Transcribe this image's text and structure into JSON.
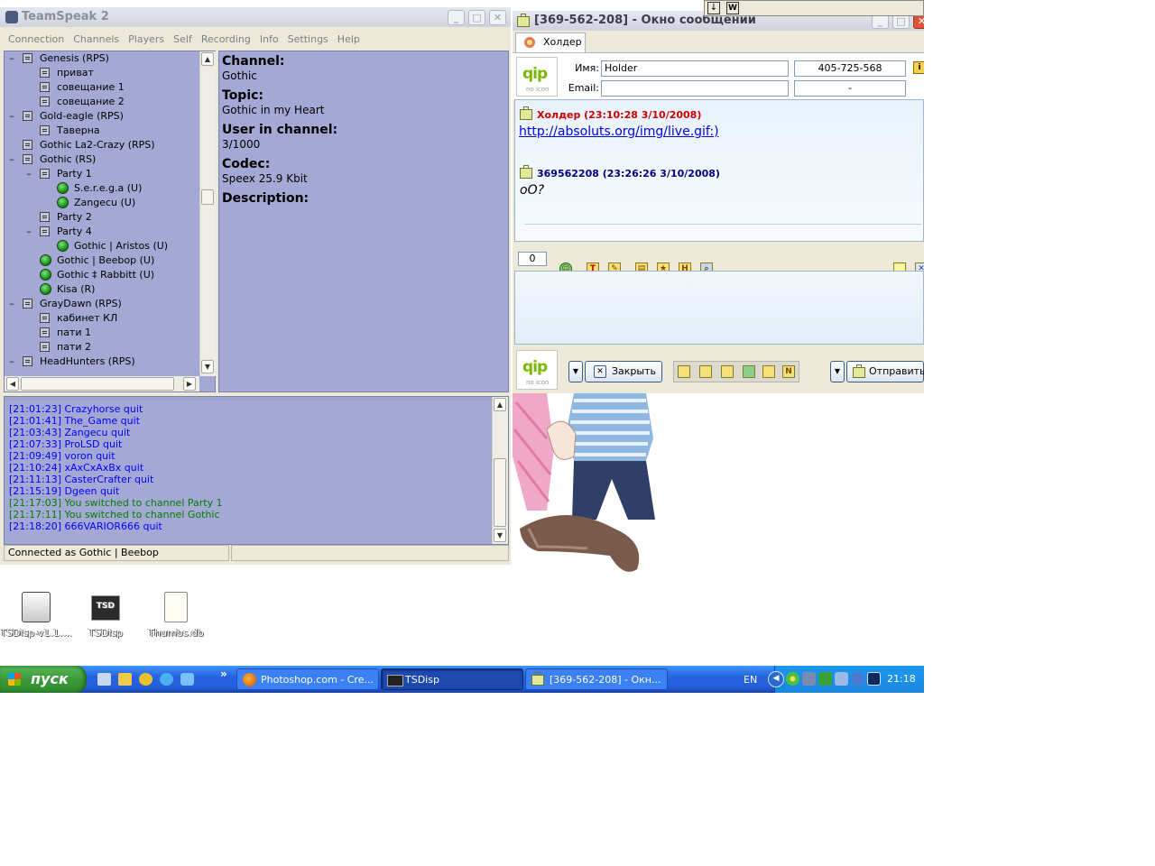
{
  "teamspeak": {
    "title": "TeamSpeak 2",
    "menu": [
      "Connection",
      "Channels",
      "Players",
      "Self",
      "Recording",
      "Info",
      "Settings",
      "Help"
    ],
    "tree": [
      {
        "toggle": "–",
        "label": "Genesis   (RPS)",
        "type": "channel"
      },
      {
        "label": "приват",
        "type": "channel"
      },
      {
        "label": "совещание 1",
        "type": "channel"
      },
      {
        "label": "совещание 2",
        "type": "channel"
      },
      {
        "toggle": "–",
        "label": "Gold-eagle   (RPS)",
        "type": "channel"
      },
      {
        "label": "Таверна",
        "type": "channel"
      },
      {
        "label": "Gothic La2-Crazy   (RPS)",
        "type": "channel"
      },
      {
        "toggle": "–",
        "label": "Gothic   (RS)",
        "type": "channel"
      },
      {
        "toggle": "–",
        "label": "Party 1",
        "type": "channel"
      },
      {
        "label": "S.e.r.e.g.a  (U)",
        "type": "user"
      },
      {
        "label": "Zangecu  (U)",
        "type": "user"
      },
      {
        "label": "Party 2",
        "type": "channel"
      },
      {
        "toggle": "–",
        "label": "Party 4",
        "type": "channel"
      },
      {
        "label": "Gothic | Aristos  (U)",
        "type": "user"
      },
      {
        "label": "Gothic | Beebop  (U)",
        "type": "user"
      },
      {
        "label": "Gothic ‡ Rabbitt  (U)",
        "type": "user"
      },
      {
        "label": "Kisa  (R)",
        "type": "user"
      },
      {
        "toggle": "–",
        "label": "GrayDawn   (RPS)",
        "type": "channel"
      },
      {
        "label": "кабинет КЛ",
        "type": "channel"
      },
      {
        "label": "пати 1",
        "type": "channel"
      },
      {
        "label": "пати 2",
        "type": "channel"
      },
      {
        "toggle": "–",
        "label": "HeadHunters   (RPS)",
        "type": "channel"
      }
    ],
    "info": {
      "channel_label": "Channel:",
      "channel_value": "Gothic",
      "topic_label": "Topic:",
      "topic_value": "Gothic in my Heart",
      "users_label": "User in channel:",
      "users_value": "3/1000",
      "codec_label": "Codec:",
      "codec_value": "Speex 25.9 Kbit",
      "description_label": "Description:"
    },
    "log": [
      {
        "text": "[21:01:23] Crazyhorse quit",
        "color": "#0000ff"
      },
      {
        "text": "[21:01:41] The_Game quit",
        "color": "#0000ff"
      },
      {
        "text": "[21:03:43] Zangecu quit",
        "color": "#0000ff"
      },
      {
        "text": "[21:07:33] ProLSD quit",
        "color": "#0000ff"
      },
      {
        "text": "[21:09:49] voron quit",
        "color": "#0000ff"
      },
      {
        "text": "[21:10:24] xAxCxAxBx quit",
        "color": "#0000ff"
      },
      {
        "text": "[21:11:13] CasterCrafter quit",
        "color": "#0000ff"
      },
      {
        "text": "[21:15:19] Dgeen quit",
        "color": "#0000ff"
      },
      {
        "text": "[21:17:03] You switched to channel Party 1",
        "color": "#008000"
      },
      {
        "text": "[21:17:11] You switched to channel Gothic",
        "color": "#008000"
      },
      {
        "text": "[21:18:20] 666VARIOR666 quit",
        "color": "#0000ff"
      }
    ],
    "status": "Connected as Gothic | Beebop"
  },
  "qip": {
    "title": "[369-562-208] - Окно сообщений",
    "tab_label": "Холдер",
    "name_label": "Имя:",
    "name_value": "Holder",
    "uin_value": "405-725-568",
    "email_label": "Email:",
    "email_value": "",
    "email_extra": "-",
    "logo_text": "qip",
    "logo_sub": "no icon",
    "messages": [
      {
        "header": "Холдер (23:10:28 3/10/2008)",
        "color": "#cc0000",
        "body": "http://absoluts.org/img/live.gif:)",
        "is_link": true
      },
      {
        "header": "369562208 (23:26:26 3/10/2008)",
        "color": "#000080",
        "body": "oO?",
        "is_link": false
      }
    ],
    "char_count": "0",
    "close_label": "Закрыть",
    "send_label": "Отправить"
  },
  "desktop_icons": [
    {
      "label": "TSDisp-v1.1....",
      "icon": "installer-icon"
    },
    {
      "label": "TSDisp",
      "icon": "tsd-shortcut-icon"
    },
    {
      "label": "Thumbs.db",
      "icon": "file-icon"
    }
  ],
  "taskbar": {
    "start_label": "пуск",
    "tasks": [
      {
        "label": "Photoshop.com - Cre...",
        "icon": "firefox-icon",
        "active": false
      },
      {
        "label": "TSDisp",
        "icon": "tsdisp-icon",
        "active": true
      },
      {
        "label": "[369-562-208] - Окн...",
        "icon": "qip-icon",
        "active": false
      }
    ],
    "language": "EN",
    "clock": "21:18"
  },
  "colors": {
    "ts_panel": "#a4a8d4",
    "taskbar": "#245edb",
    "start": "#3a9a3a",
    "log_quit": "#0000ff",
    "log_switch": "#008000"
  }
}
